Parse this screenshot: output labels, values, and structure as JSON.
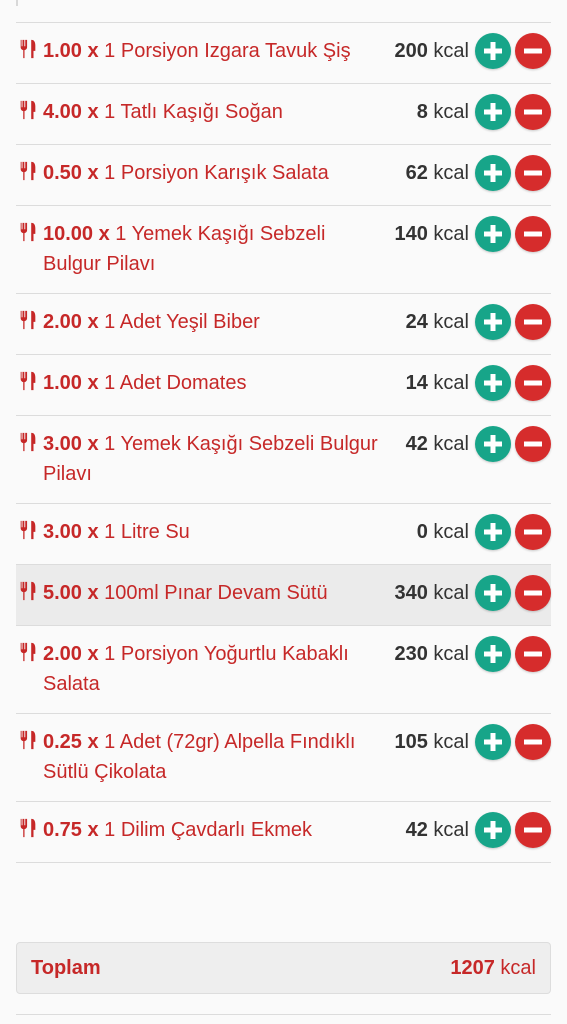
{
  "colors": {
    "accent_red": "#c62828",
    "plus_green": "#17a589",
    "minus_red": "#d62c2c",
    "kcal_text": "#333333"
  },
  "meals": [
    {
      "qty": "1.00 x",
      "desc": "1 Porsiyon Izgara Tavuk Şiş",
      "kcal": "200",
      "unit": "kcal"
    },
    {
      "qty": "4.00 x",
      "desc": "1 Tatlı Kaşığı Soğan",
      "kcal": "8",
      "unit": "kcal"
    },
    {
      "qty": "0.50 x",
      "desc": "1 Porsiyon Karışık Salata",
      "kcal": "62",
      "unit": "kcal"
    },
    {
      "qty": "10.00 x",
      "desc": "1 Yemek Kaşığı Sebzeli Bulgur Pilavı",
      "kcal": "140",
      "unit": "kcal"
    },
    {
      "qty": "2.00 x",
      "desc": "1 Adet Yeşil Biber",
      "kcal": "24",
      "unit": "kcal"
    },
    {
      "qty": "1.00 x",
      "desc": "1 Adet Domates",
      "kcal": "14",
      "unit": "kcal"
    },
    {
      "qty": "3.00 x",
      "desc": "1 Yemek Kaşığı Sebzeli Bulgur Pilavı",
      "kcal": "42",
      "unit": "kcal"
    },
    {
      "qty": "3.00 x",
      "desc": "1 Litre Su",
      "kcal": "0",
      "unit": "kcal"
    },
    {
      "qty": "5.00 x",
      "desc": "100ml Pınar Devam Sütü",
      "kcal": "340",
      "unit": "kcal"
    },
    {
      "qty": "2.00 x",
      "desc": "1 Porsiyon Yoğurtlu Kabaklı Salata",
      "kcal": "230",
      "unit": "kcal"
    },
    {
      "qty": "0.25 x",
      "desc": "1 Adet (72gr) Alpella Fındıklı Sütlü Çikolata",
      "kcal": "105",
      "unit": "kcal"
    },
    {
      "qty": "0.75 x",
      "desc": "1 Dilim Çavdarlı Ekmek",
      "kcal": "42",
      "unit": "kcal"
    }
  ],
  "icons": {
    "item": "utensils-icon",
    "increase": "plus-circle-icon",
    "decrease": "minus-circle-icon"
  },
  "total": {
    "label": "Toplam",
    "value": "1207",
    "unit": "kcal"
  }
}
